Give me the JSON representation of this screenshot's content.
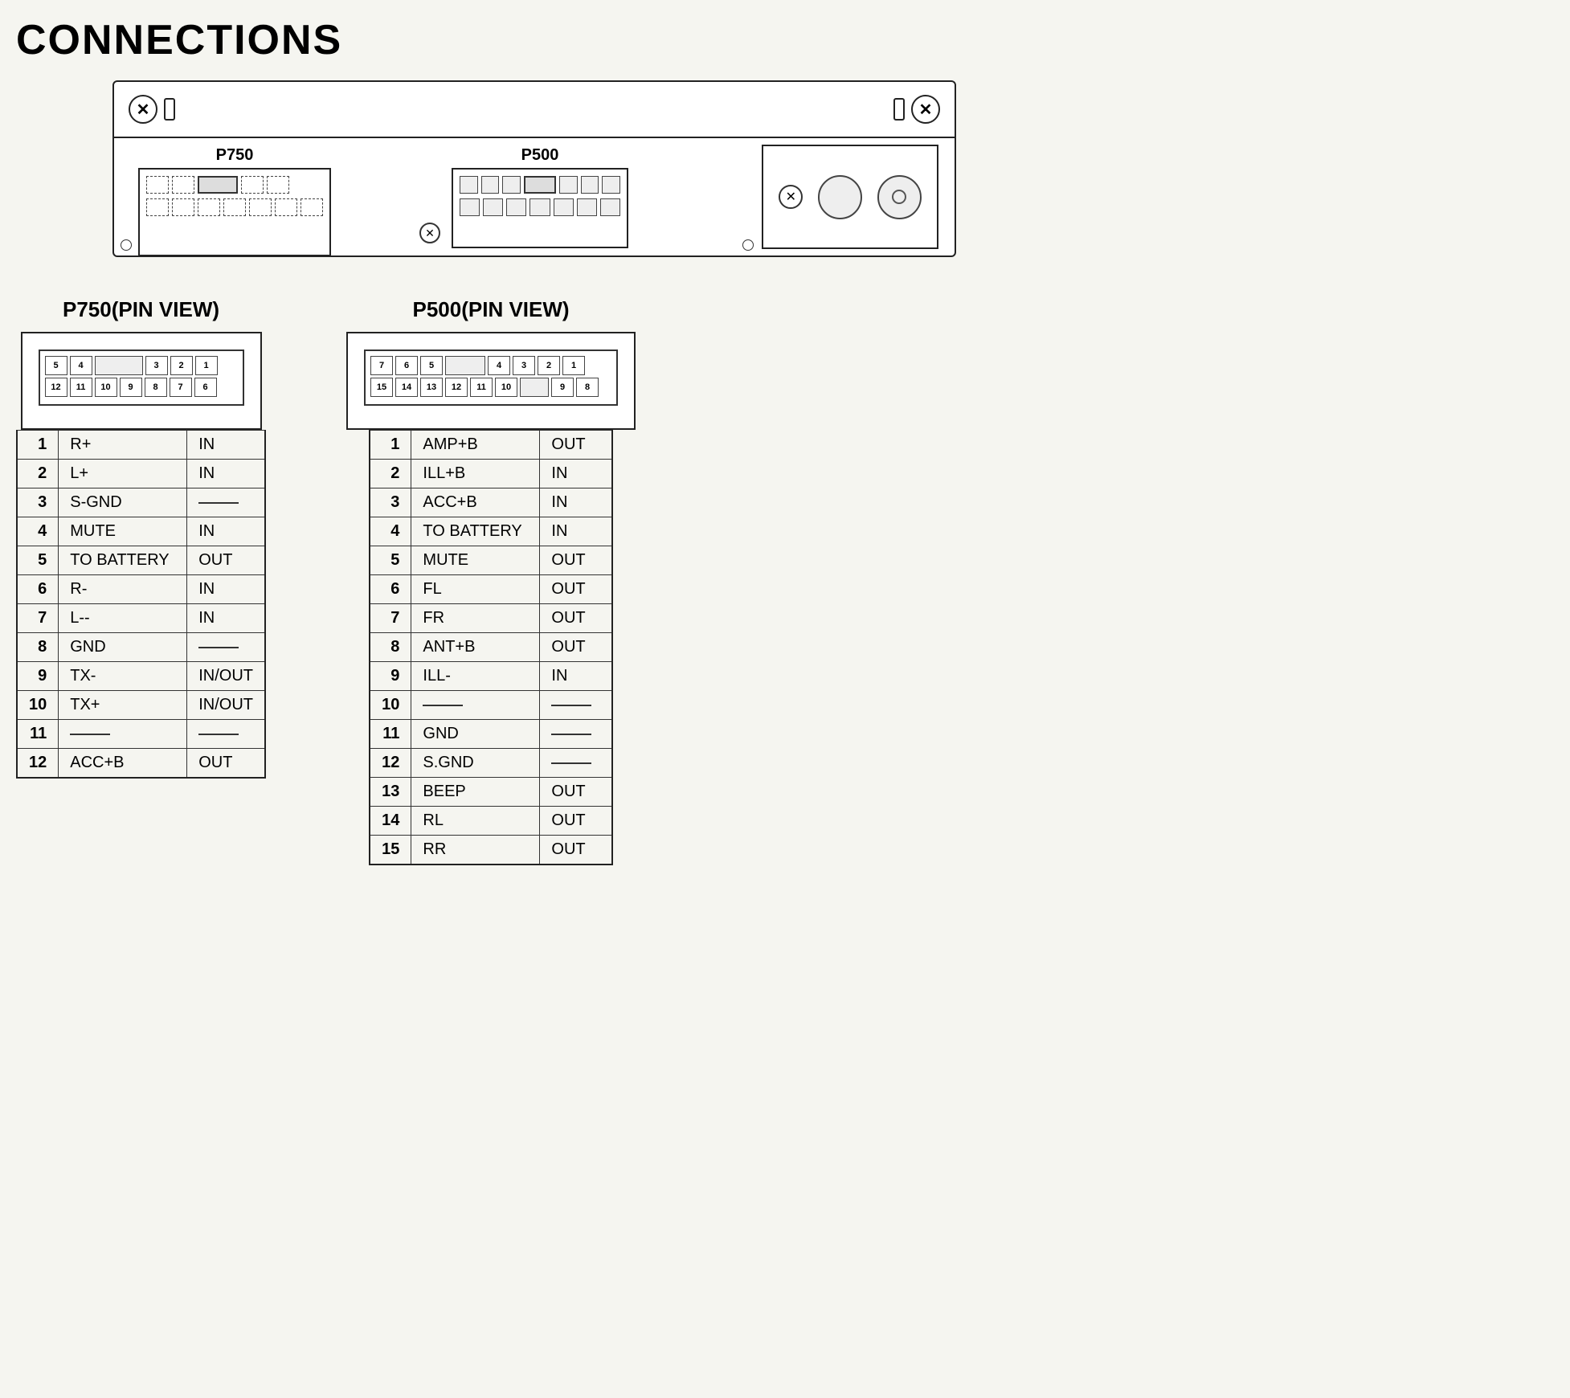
{
  "page": {
    "title": "CONNECTIONS"
  },
  "connectors": {
    "p750_label": "P750",
    "p500_label": "P500",
    "p750_pin_view_label": "P750(PIN VIEW)",
    "p500_pin_view_label": "P500(PIN VIEW)"
  },
  "p750_pins": {
    "top_row": [
      "5",
      "4",
      "",
      "3",
      "2",
      "1"
    ],
    "bottom_row": [
      "12",
      "11",
      "10",
      "9",
      "8",
      "7",
      "6"
    ]
  },
  "p500_pins": {
    "top_row": [
      "7",
      "6",
      "5",
      "",
      "4",
      "3",
      "2",
      "1"
    ],
    "bottom_row": [
      "15",
      "14",
      "13",
      "12",
      "11",
      "10",
      "",
      "9",
      "8"
    ]
  },
  "p750_table": {
    "rows": [
      {
        "pin": "1",
        "signal": "R+",
        "dir": "IN"
      },
      {
        "pin": "2",
        "signal": "L+",
        "dir": "IN"
      },
      {
        "pin": "3",
        "signal": "S-GND",
        "dir": "—"
      },
      {
        "pin": "4",
        "signal": "MUTE",
        "dir": "IN"
      },
      {
        "pin": "5",
        "signal": "TO BATTERY",
        "dir": "OUT"
      },
      {
        "pin": "6",
        "signal": "R-",
        "dir": "IN"
      },
      {
        "pin": "7",
        "signal": "L--",
        "dir": "IN"
      },
      {
        "pin": "8",
        "signal": "GND",
        "dir": "—"
      },
      {
        "pin": "9",
        "signal": "TX-",
        "dir": "IN/OUT"
      },
      {
        "pin": "10",
        "signal": "TX+",
        "dir": "IN/OUT"
      },
      {
        "pin": "11",
        "signal": "—",
        "dir": "—"
      },
      {
        "pin": "12",
        "signal": "ACC+B",
        "dir": "OUT"
      }
    ]
  },
  "p500_table": {
    "rows": [
      {
        "pin": "1",
        "signal": "AMP+B",
        "dir": "OUT"
      },
      {
        "pin": "2",
        "signal": "ILL+B",
        "dir": "IN"
      },
      {
        "pin": "3",
        "signal": "ACC+B",
        "dir": "IN"
      },
      {
        "pin": "4",
        "signal": "TO BATTERY",
        "dir": "IN"
      },
      {
        "pin": "5",
        "signal": "MUTE",
        "dir": "OUT"
      },
      {
        "pin": "6",
        "signal": "FL",
        "dir": "OUT"
      },
      {
        "pin": "7",
        "signal": "FR",
        "dir": "OUT"
      },
      {
        "pin": "8",
        "signal": "ANT+B",
        "dir": "OUT"
      },
      {
        "pin": "9",
        "signal": "ILL-",
        "dir": "IN"
      },
      {
        "pin": "10",
        "signal": "—",
        "dir": "—"
      },
      {
        "pin": "11",
        "signal": "GND",
        "dir": "—"
      },
      {
        "pin": "12",
        "signal": "S.GND",
        "dir": "—"
      },
      {
        "pin": "13",
        "signal": "BEEP",
        "dir": "OUT"
      },
      {
        "pin": "14",
        "signal": "RL",
        "dir": "OUT"
      },
      {
        "pin": "15",
        "signal": "RR",
        "dir": "OUT"
      }
    ]
  }
}
